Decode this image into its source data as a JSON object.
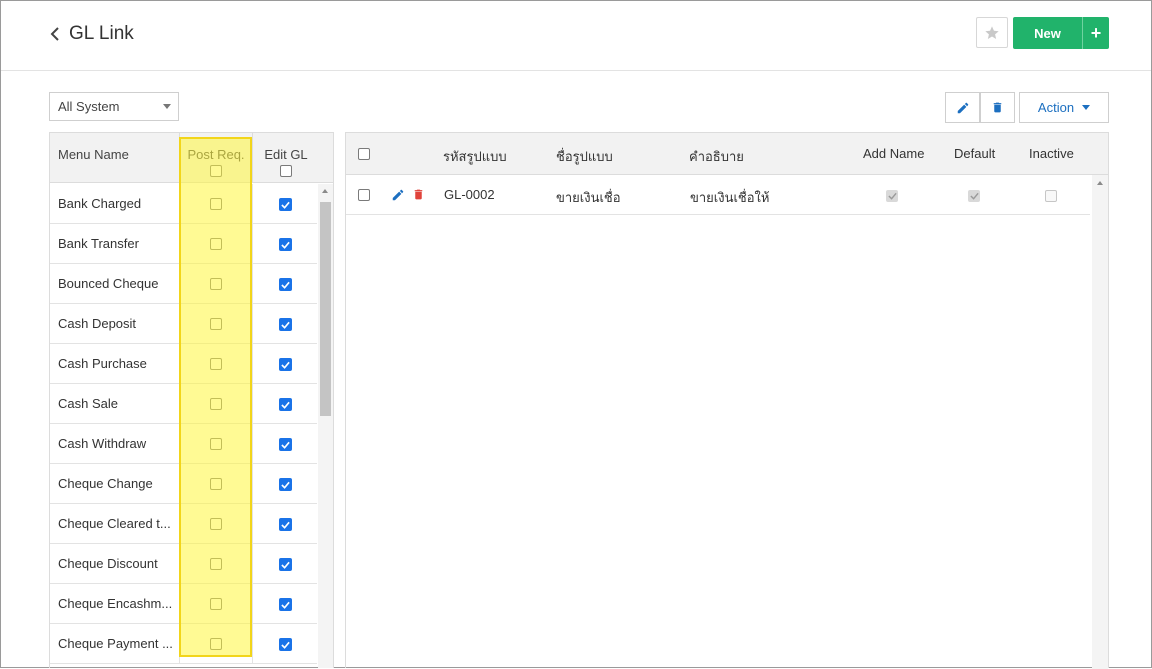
{
  "header": {
    "back_icon": "chevron-left-icon",
    "title": "GL Link",
    "favorite_icon": "star-icon",
    "new_label": "New",
    "new_plus": "+"
  },
  "toolbar": {
    "filter_value": "All System",
    "edit_icon": "pencil-icon",
    "delete_icon": "trash-icon",
    "action_label": "Action"
  },
  "left_table": {
    "headers": {
      "menu_name": "Menu Name",
      "post_req": "Post Req.",
      "edit_gl": "Edit GL"
    },
    "rows": [
      {
        "name": "Bank Charged",
        "post_req": false,
        "edit_gl": true
      },
      {
        "name": "Bank Transfer",
        "post_req": false,
        "edit_gl": true
      },
      {
        "name": "Bounced Cheque",
        "post_req": false,
        "edit_gl": true
      },
      {
        "name": "Cash Deposit",
        "post_req": false,
        "edit_gl": true
      },
      {
        "name": "Cash Purchase",
        "post_req": false,
        "edit_gl": true
      },
      {
        "name": "Cash Sale",
        "post_req": false,
        "edit_gl": true
      },
      {
        "name": "Cash Withdraw",
        "post_req": false,
        "edit_gl": true
      },
      {
        "name": "Cheque Change",
        "post_req": false,
        "edit_gl": true
      },
      {
        "name": "Cheque Cleared t...",
        "post_req": false,
        "edit_gl": true
      },
      {
        "name": "Cheque Discount",
        "post_req": false,
        "edit_gl": true
      },
      {
        "name": "Cheque Encashm...",
        "post_req": false,
        "edit_gl": true
      },
      {
        "name": "Cheque Payment ...",
        "post_req": false,
        "edit_gl": true
      }
    ]
  },
  "right_table": {
    "headers": {
      "code": "รหัสรูปแบบ",
      "name": "ชื่อรูปแบบ",
      "description": "คำอธิบาย",
      "add_name": "Add Name",
      "default": "Default",
      "inactive": "Inactive"
    },
    "rows": [
      {
        "code": "GL-0002",
        "name": "ขายเงินเชื่อ",
        "description": "ขายเงินเชื่อให้",
        "add_name": true,
        "default": true,
        "inactive": false
      }
    ]
  },
  "colors": {
    "primary_green": "#21b36b",
    "accent_blue": "#1c6fc0",
    "delete_red": "#e0433b",
    "highlight_yellow": "#fff63c"
  }
}
